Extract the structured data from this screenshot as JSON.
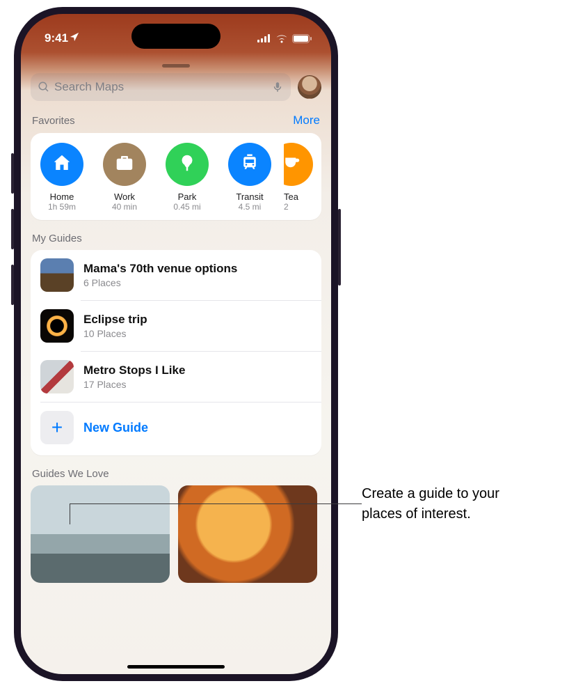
{
  "status": {
    "time": "9:41",
    "location_services": true
  },
  "search": {
    "placeholder": "Search Maps"
  },
  "favorites": {
    "title": "Favorites",
    "more": "More",
    "items": [
      {
        "label": "Home",
        "sub": "1h 59m",
        "color": "#0a84ff",
        "icon": "home"
      },
      {
        "label": "Work",
        "sub": "40 min",
        "color": "#a2845e",
        "icon": "briefcase"
      },
      {
        "label": "Park",
        "sub": "0.45 mi",
        "color": "#30d158",
        "icon": "tree"
      },
      {
        "label": "Transit",
        "sub": "4.5 mi",
        "color": "#0a84ff",
        "icon": "tram"
      },
      {
        "label": "Tea",
        "sub": "2",
        "color": "#ff9500",
        "icon": "cup"
      }
    ]
  },
  "my_guides": {
    "title": "My Guides",
    "items": [
      {
        "title": "Mama's 70th venue options",
        "sub": "6 Places"
      },
      {
        "title": "Eclipse trip",
        "sub": "10 Places"
      },
      {
        "title": "Metro Stops I Like",
        "sub": "17 Places"
      }
    ],
    "new_guide": "New Guide"
  },
  "guides_we_love": {
    "title": "Guides We Love"
  },
  "callout": {
    "line1": "Create a guide to your",
    "line2": "places of interest."
  }
}
